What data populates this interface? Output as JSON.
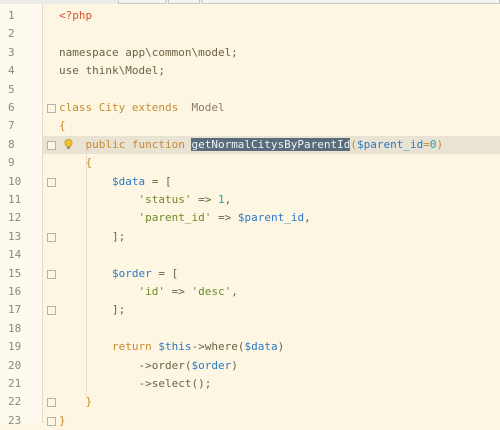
{
  "editor": {
    "line_numbers": [
      "1",
      "2",
      "3",
      "4",
      "5",
      "6",
      "7",
      "8",
      "9",
      "10",
      "11",
      "12",
      "13",
      "14",
      "15",
      "16",
      "17",
      "18",
      "19",
      "20",
      "21",
      "22",
      "23"
    ],
    "highlighted_line": 8,
    "selected_text": "getNormalCitysByParentId",
    "lines": [
      [
        {
          "t": "<?php",
          "c": "tag"
        }
      ],
      [],
      [
        {
          "t": "namespace app\\common\\model;",
          "c": "plain"
        }
      ],
      [
        {
          "t": "use think\\Model;",
          "c": "plain"
        }
      ],
      [],
      [
        {
          "t": "class ",
          "c": "kw"
        },
        {
          "t": "City ",
          "c": "kw"
        },
        {
          "t": "extends  ",
          "c": "kw"
        },
        {
          "t": "Model",
          "c": "cls"
        }
      ],
      [
        {
          "t": "{",
          "c": "kw"
        }
      ],
      [
        {
          "t": "    public function ",
          "c": "kw"
        },
        {
          "t": "getNormalCitysByParentId",
          "c": "sel"
        },
        {
          "t": "(",
          "c": "kw"
        },
        {
          "t": "$parent_id",
          "c": "var"
        },
        {
          "t": "=",
          "c": "kw"
        },
        {
          "t": "0",
          "c": "num"
        },
        {
          "t": ")",
          "c": "kw"
        }
      ],
      [
        {
          "t": "    {",
          "c": "kw"
        }
      ],
      [
        {
          "t": "        ",
          "c": "plain"
        },
        {
          "t": "$data",
          "c": "var"
        },
        {
          "t": " = [",
          "c": "plain"
        }
      ],
      [
        {
          "t": "            ",
          "c": "plain"
        },
        {
          "t": "'status'",
          "c": "str"
        },
        {
          "t": " => ",
          "c": "plain"
        },
        {
          "t": "1",
          "c": "num"
        },
        {
          "t": ",",
          "c": "plain"
        }
      ],
      [
        {
          "t": "            ",
          "c": "plain"
        },
        {
          "t": "'parent_id'",
          "c": "str"
        },
        {
          "t": " => ",
          "c": "plain"
        },
        {
          "t": "$parent_id",
          "c": "var"
        },
        {
          "t": ",",
          "c": "plain"
        }
      ],
      [
        {
          "t": "        ];",
          "c": "plain"
        }
      ],
      [],
      [
        {
          "t": "        ",
          "c": "plain"
        },
        {
          "t": "$order",
          "c": "var"
        },
        {
          "t": " = [",
          "c": "plain"
        }
      ],
      [
        {
          "t": "            ",
          "c": "plain"
        },
        {
          "t": "'id'",
          "c": "str"
        },
        {
          "t": " => ",
          "c": "plain"
        },
        {
          "t": "'desc'",
          "c": "str"
        },
        {
          "t": ",",
          "c": "plain"
        }
      ],
      [
        {
          "t": "        ];",
          "c": "plain"
        }
      ],
      [],
      [
        {
          "t": "        return ",
          "c": "kw"
        },
        {
          "t": "$this",
          "c": "var"
        },
        {
          "t": "->where(",
          "c": "plain"
        },
        {
          "t": "$data",
          "c": "var"
        },
        {
          "t": ")",
          "c": "plain"
        }
      ],
      [
        {
          "t": "            ->order(",
          "c": "plain"
        },
        {
          "t": "$order",
          "c": "var"
        },
        {
          "t": ")",
          "c": "plain"
        }
      ],
      [
        {
          "t": "            ->select();",
          "c": "plain"
        }
      ],
      [
        {
          "t": "    }",
          "c": "kw"
        }
      ],
      [
        {
          "t": "}",
          "c": "kw"
        }
      ]
    ],
    "fold_markers": [
      6,
      8,
      10,
      13,
      15,
      17,
      22,
      23
    ],
    "bulb_line": 8
  }
}
